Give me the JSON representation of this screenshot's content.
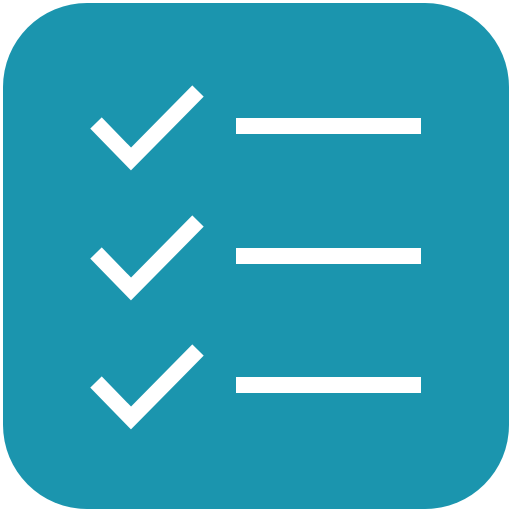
{
  "icon": {
    "name": "checklist-icon",
    "background_color": "#1b95ae",
    "foreground_color": "#ffffff",
    "items": [
      {
        "check_icon": "check-icon",
        "line_icon": "line-icon"
      },
      {
        "check_icon": "check-icon",
        "line_icon": "line-icon"
      },
      {
        "check_icon": "check-icon",
        "line_icon": "line-icon"
      }
    ]
  }
}
